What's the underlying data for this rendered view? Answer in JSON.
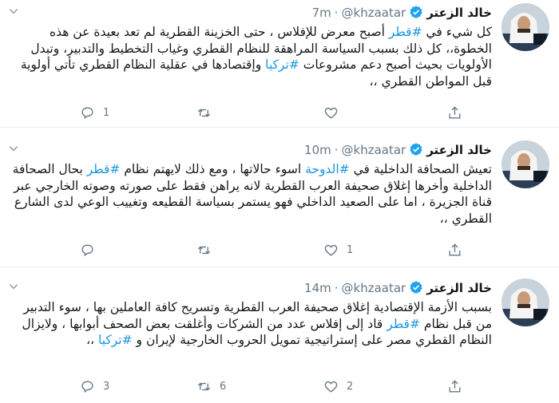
{
  "tweets": [
    {
      "name": "خالد الزعتر",
      "handle": "@khzaatar",
      "time": "7m",
      "text_parts": [
        {
          "t": "كل شيء في ",
          "tag": false
        },
        {
          "t": "#قطر",
          "tag": true
        },
        {
          "t": " أصبح معرض للإفلاس ، حتى الخزينة القطرية لم تعد بعيدة عن هذه الخطوة،، كل ذلك بسبب السياسة المراهقة للنظام القطري وغياب التخطيط والتدبير، وتبدل الأولويات بحيث أصبح دعم مشروعات ",
          "tag": false
        },
        {
          "t": "#تركيا",
          "tag": true
        },
        {
          "t": " وإقتصادها في عقلية النظام القطري تأتي أولوية قبل المواطن القطري ،،",
          "tag": false
        }
      ],
      "replies": "1",
      "retweets": "",
      "likes": ""
    },
    {
      "name": "خالد الزعتر",
      "handle": "@khzaatar",
      "time": "10m",
      "text_parts": [
        {
          "t": "تعيش الصحافة الداخلية في ",
          "tag": false
        },
        {
          "t": "#الدوحة",
          "tag": true
        },
        {
          "t": " اسوء حالاتها ، ومع ذلك لايهتم نظام ",
          "tag": false
        },
        {
          "t": "#قطر",
          "tag": true
        },
        {
          "t": " بحال الصحافة الداخلية وأخرها إغلاق صحيفة العرب القطرية لانه يراهن فقط على صورته وصوته الخارجي عبر قناة الجزيرة ، اما على الصعيد الداخلي فهو يستمر بسياسة القطيعه وتغييب الوعي لدى الشارع القطري ،،",
          "tag": false
        }
      ],
      "replies": "",
      "retweets": "",
      "likes": "1"
    },
    {
      "name": "خالد الزعتر",
      "handle": "@khzaatar",
      "time": "14m",
      "text_parts": [
        {
          "t": "بسبب الأزمة الإقتصادية إغلاق صحيفة العرب القطرية وتسريح كافة العاملين بها ، سوء التدبير من قبل نظام ",
          "tag": false
        },
        {
          "t": "#قطر",
          "tag": true
        },
        {
          "t": " قاد إلى إفلاس عدد من الشركات وأغلقت بعض الصحف أبوابها ، ولايزال النظام القطري مصر على إستراتيجية تمويل الحروب الخارجية لإيران و ",
          "tag": false
        },
        {
          "t": "#تركيا",
          "tag": true
        },
        {
          "t": " ،،",
          "tag": false
        }
      ],
      "replies": "3",
      "retweets": "6",
      "likes": "2"
    }
  ],
  "icons": {
    "more": "chevron-down-icon",
    "verified": "verified-badge-icon",
    "reply": "reply-icon",
    "retweet": "retweet-icon",
    "like": "heart-icon",
    "share": "share-icon"
  },
  "colors": {
    "hashtag": "#1b95e0",
    "verified": "#1da1f2",
    "muted": "#657786"
  }
}
